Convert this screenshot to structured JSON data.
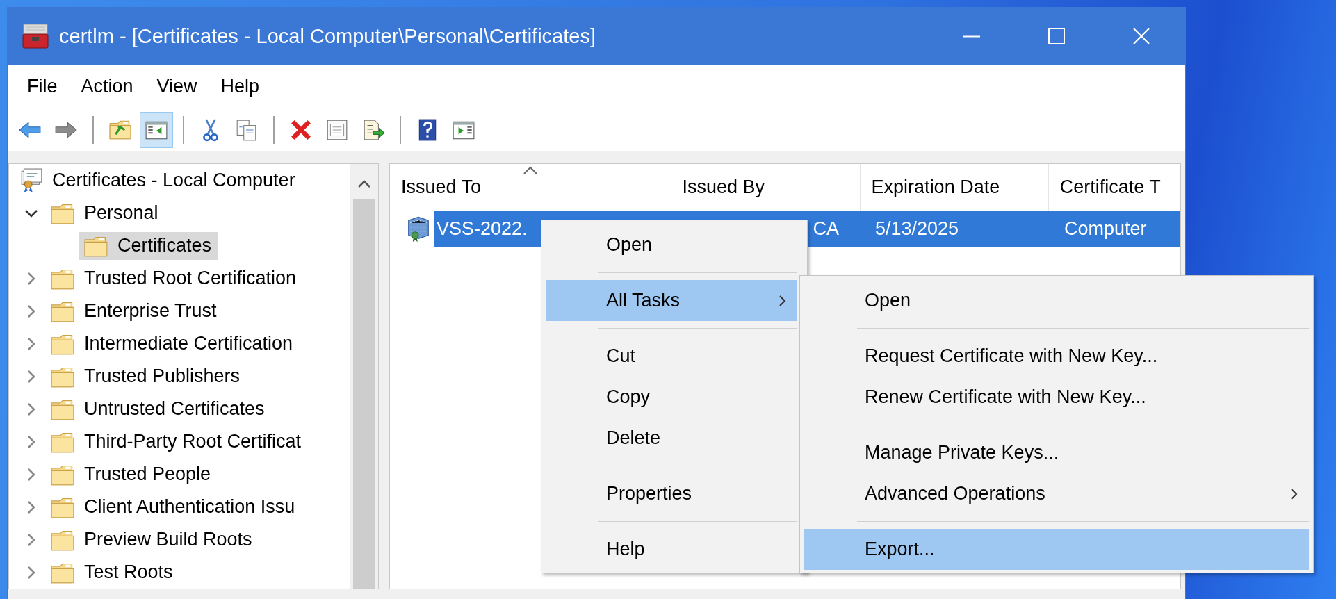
{
  "window": {
    "title": "certlm - [Certificates - Local Computer\\Personal\\Certificates]"
  },
  "menu_bar": [
    "File",
    "Action",
    "View",
    "Help"
  ],
  "toolbar": [
    {
      "kind": "back",
      "pressed": false
    },
    {
      "kind": "forward",
      "pressed": false
    },
    {
      "kind": "separator"
    },
    {
      "kind": "up-folder",
      "pressed": false
    },
    {
      "kind": "console-tree",
      "pressed": true
    },
    {
      "kind": "separator"
    },
    {
      "kind": "cut",
      "pressed": false
    },
    {
      "kind": "copy",
      "pressed": false
    },
    {
      "kind": "separator"
    },
    {
      "kind": "delete",
      "pressed": false
    },
    {
      "kind": "properties",
      "pressed": false
    },
    {
      "kind": "export",
      "pressed": false
    },
    {
      "kind": "separator"
    },
    {
      "kind": "help",
      "pressed": false
    },
    {
      "kind": "action-pane",
      "pressed": false
    }
  ],
  "tree": {
    "root": {
      "label": "Certificates - Local Computer",
      "selected": false,
      "children": [
        {
          "label": "Personal",
          "expanded": true,
          "selected": false,
          "children": [
            {
              "label": "Certificates",
              "selected": true
            }
          ]
        },
        {
          "label": "Trusted Root Certification",
          "expanded": false,
          "selected": false
        },
        {
          "label": "Enterprise Trust",
          "expanded": false,
          "selected": false
        },
        {
          "label": "Intermediate Certification",
          "expanded": false,
          "selected": false
        },
        {
          "label": "Trusted Publishers",
          "expanded": false,
          "selected": false
        },
        {
          "label": "Untrusted Certificates",
          "expanded": false,
          "selected": false
        },
        {
          "label": "Third-Party Root Certificat",
          "expanded": false,
          "selected": false
        },
        {
          "label": "Trusted People",
          "expanded": false,
          "selected": false
        },
        {
          "label": "Client Authentication Issu",
          "expanded": false,
          "selected": false
        },
        {
          "label": "Preview Build Roots",
          "expanded": false,
          "selected": false
        },
        {
          "label": "Test Roots",
          "expanded": false,
          "selected": false
        }
      ]
    }
  },
  "list": {
    "columns": [
      {
        "label": "Issued To",
        "sorted": true
      },
      {
        "label": "Issued By",
        "sorted": false
      },
      {
        "label": "Expiration Date",
        "sorted": false
      },
      {
        "label": "Certificate T",
        "sorted": false
      }
    ],
    "rows": [
      {
        "selected": true,
        "cells": [
          "VSS-2022.",
          "CA",
          "5/13/2025",
          "Computer"
        ]
      }
    ]
  },
  "context_menu": {
    "items": [
      {
        "kind": "item",
        "label": "Open",
        "selected": false,
        "has_submenu": false
      },
      {
        "kind": "separator"
      },
      {
        "kind": "item",
        "label": "All Tasks",
        "selected": true,
        "has_submenu": true
      },
      {
        "kind": "separator"
      },
      {
        "kind": "item",
        "label": "Cut",
        "selected": false,
        "has_submenu": false
      },
      {
        "kind": "item",
        "label": "Copy",
        "selected": false,
        "has_submenu": false
      },
      {
        "kind": "item",
        "label": "Delete",
        "selected": false,
        "has_submenu": false
      },
      {
        "kind": "separator"
      },
      {
        "kind": "item",
        "label": "Properties",
        "selected": false,
        "has_submenu": false
      },
      {
        "kind": "separator"
      },
      {
        "kind": "item",
        "label": "Help",
        "selected": false,
        "has_submenu": false
      }
    ]
  },
  "submenu": {
    "items": [
      {
        "kind": "item",
        "label": "Open",
        "selected": false,
        "has_submenu": false
      },
      {
        "kind": "separator"
      },
      {
        "kind": "item",
        "label": "Request Certificate with New Key...",
        "selected": false,
        "has_submenu": false
      },
      {
        "kind": "item",
        "label": "Renew Certificate with New Key...",
        "selected": false,
        "has_submenu": false
      },
      {
        "kind": "separator"
      },
      {
        "kind": "item",
        "label": "Manage Private Keys...",
        "selected": false,
        "has_submenu": false
      },
      {
        "kind": "item",
        "label": "Advanced Operations",
        "selected": false,
        "has_submenu": true
      },
      {
        "kind": "separator"
      },
      {
        "kind": "item",
        "label": "Export...",
        "selected": true,
        "has_submenu": false
      }
    ]
  }
}
